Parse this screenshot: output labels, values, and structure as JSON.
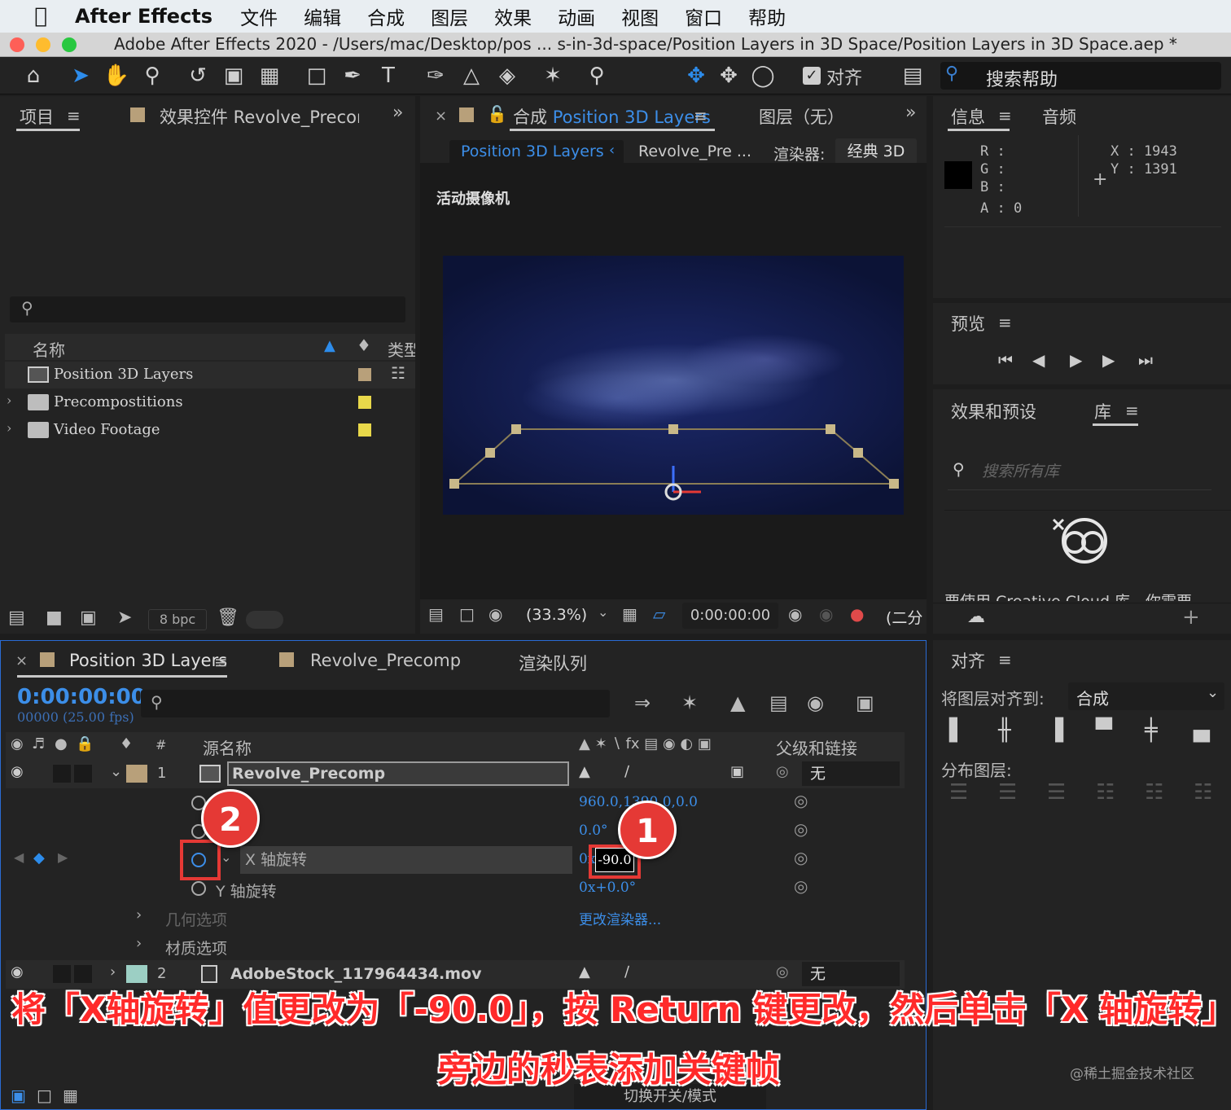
{
  "menubar": {
    "app_name": "After Effects",
    "items": [
      "文件",
      "编辑",
      "合成",
      "图层",
      "效果",
      "动画",
      "视图",
      "窗口",
      "帮助"
    ]
  },
  "window_title": "Adobe After Effects 2020 - /Users/mac/Desktop/pos ... s-in-3d-space/Position Layers in 3D Space/Position Layers in 3D Space.aep *",
  "toolbar": {
    "align_label": "对齐",
    "search_help": "搜索帮助"
  },
  "project_panel": {
    "tab_project": "项目",
    "tab_effects": "效果控件 Revolve_Precomp",
    "col_name": "名称",
    "col_type": "类型",
    "items": [
      {
        "label": "Position 3D Layers",
        "swatch": "#b8a07a"
      },
      {
        "label": "Precompostitions",
        "swatch": "#e8d84a"
      },
      {
        "label": "Video Footage",
        "swatch": "#e8d84a"
      }
    ],
    "bpc": "8 bpc"
  },
  "comp_panel": {
    "tab_label_prefix": "合成",
    "tab_label_name": "Position 3D Layers",
    "layer_tab": "图层（无）",
    "breadcrumb_active": "Position 3D Layers",
    "breadcrumb_next": "Revolve_Pre ...",
    "renderer_label": "渲染器:",
    "renderer_value": "经典 3D",
    "camera_label": "活动摄像机",
    "zoom": "(33.3%)",
    "timecode": "0:00:00:00",
    "resolution": "(二分"
  },
  "info_panel": {
    "tab_info": "信息",
    "tab_audio": "音频",
    "r": "R :",
    "g": "G :",
    "b": "B :",
    "a": "A :  0",
    "x": "X : 1943",
    "y": "Y : 1391"
  },
  "preview_panel": {
    "title": "预览"
  },
  "effects_panel": {
    "tab_effects": "效果和预设",
    "tab_library": "库",
    "search_placeholder": "搜索所有库",
    "cut_text": "要使用 Creative Cloud 库，你需要"
  },
  "align_panel": {
    "title": "对齐",
    "align_to_label": "将图层对齐到:",
    "align_to_value": "合成",
    "distribute_label": "分布图层:"
  },
  "timeline": {
    "tab_main": "Position 3D Layers",
    "tab_precomp": "Revolve_Precomp",
    "tab_render": "渲染队列",
    "timecode": "0:00:00:00",
    "frames": "00000 (25.00 fps)",
    "col_hash": "#",
    "col_source": "源名称",
    "col_parent": "父级和链接",
    "layer1": {
      "num": "1",
      "name": "Revolve_Precomp",
      "parent": "无"
    },
    "prop_position_value": "960.0,1390.0,0.0",
    "prop_zrot_value": "0.0°",
    "prop_x_label": "X 轴旋转",
    "prop_x_prefix": "0x",
    "prop_x_value": "-90.0",
    "prop_x_suffix": "°",
    "prop_y_label": "Y 轴旋转",
    "prop_y_value": "0x+0.0°",
    "geometry": "几何选项",
    "change_renderer": "更改渲染器...",
    "material": "材质选项",
    "layer2": {
      "num": "2",
      "name": "AdobeStock_117964434.mov",
      "parent": "无"
    },
    "footer_toggle": "切换开关/模式"
  },
  "annotations": {
    "badge1": "1",
    "badge2": "2",
    "caption_line1": "将「X轴旋转」值更改为「-90.0」，按 Return 键更改，然后单击「X 轴旋转」",
    "caption_line2": "旁边的秒表添加关键帧",
    "watermark": "@稀土掘金技术社区"
  }
}
